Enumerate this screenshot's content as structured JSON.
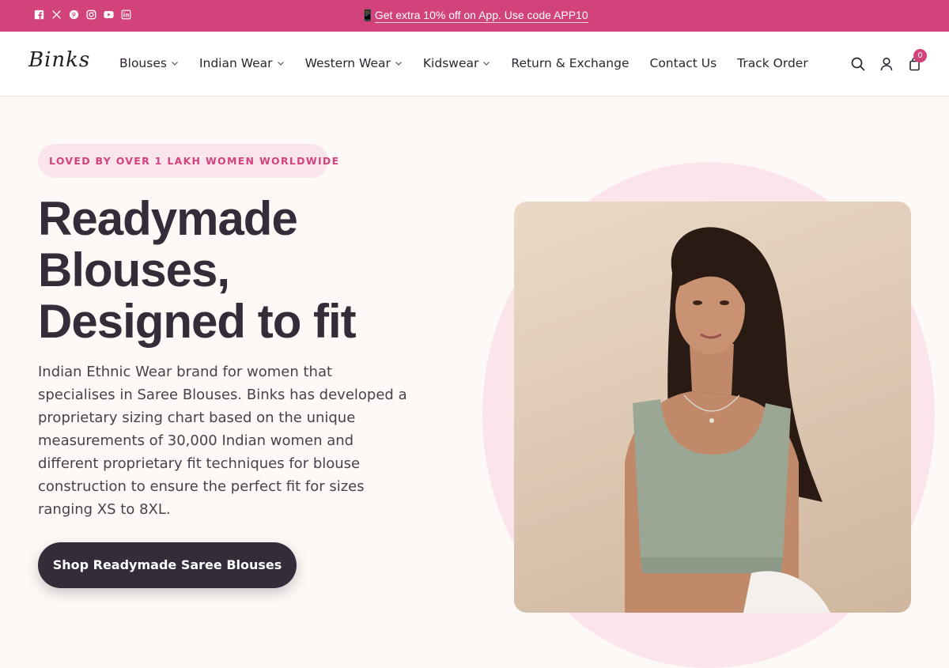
{
  "announcement": {
    "emoji": "📱",
    "text": "Get extra 10% off on App. Use code APP10",
    "social_icons": [
      "facebook-icon",
      "x-icon",
      "pinterest-icon",
      "instagram-icon",
      "youtube-icon",
      "linkedin-icon"
    ]
  },
  "header": {
    "logo": "Binks",
    "nav": [
      {
        "label": "Blouses",
        "dropdown": true
      },
      {
        "label": "Indian Wear",
        "dropdown": true
      },
      {
        "label": "Western Wear",
        "dropdown": true
      },
      {
        "label": "Kidswear",
        "dropdown": true
      },
      {
        "label": "Return & Exchange",
        "dropdown": false
      },
      {
        "label": "Contact Us",
        "dropdown": false
      },
      {
        "label": "Track Order",
        "dropdown": false
      }
    ],
    "cart_count": "0"
  },
  "hero": {
    "badge": "LOVED BY OVER 1 LAKH WOMEN WORLDWIDE",
    "headline_line1": "Readymade",
    "headline_line2": "Blouses,",
    "headline_line3": "Designed to fit",
    "description": "Indian Ethnic Wear brand for women that specialises in Saree Blouses. Binks has developed a proprietary sizing chart based on the unique measurements of 30,000 Indian women and different proprietary fit techniques for blouse construction to ensure the perfect fit for sizes ranging XS to 8XL.",
    "cta_label": "Shop Readymade Saree Blouses"
  },
  "colors": {
    "brand_pink": "#d2427b",
    "dark": "#342c38",
    "badge_bg": "#fbe5ec",
    "page_bg": "#fdf9f6"
  }
}
